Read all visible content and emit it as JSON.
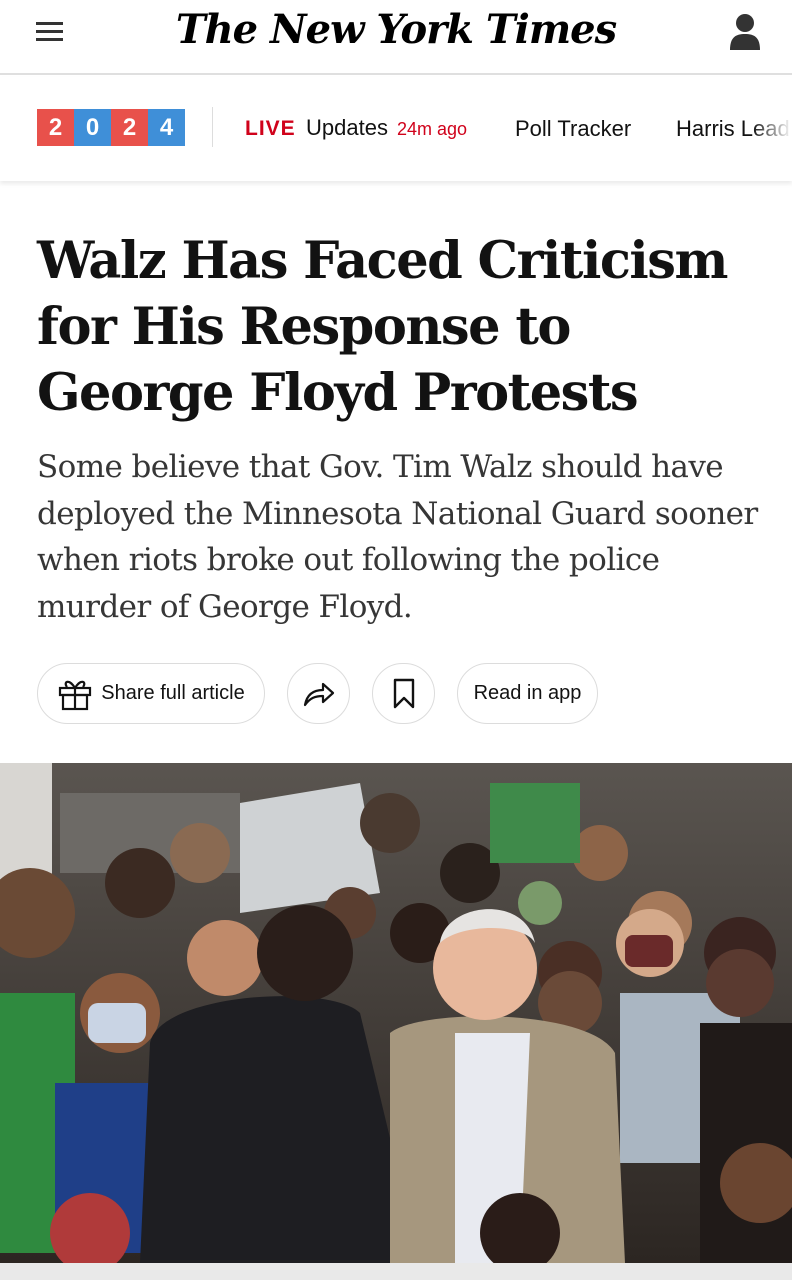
{
  "masthead": {
    "logo_text": "The New York Times",
    "menu_icon": "hamburger-menu-icon",
    "account_icon": "account-user-icon"
  },
  "subnav": {
    "year_digits": [
      "2",
      "0",
      "2",
      "4"
    ],
    "year_colors": [
      "#e8514b",
      "#3f8fd8",
      "#e8514b",
      "#3f8fd8"
    ],
    "live_label": "LIVE",
    "updates_label": "Updates",
    "updated_ago": "24m ago",
    "links": [
      "Poll Tracker",
      "Harris Lead"
    ]
  },
  "article": {
    "headline": "Walz Has Faced Criticism for His Response to George Floyd Protests",
    "summary": "Some believe that Gov. Tim Walz should have deployed the Minnesota National Guard sooner when riots broke out following the police murder of George Floyd."
  },
  "actions": {
    "share_label": "Share full article",
    "share_icon": "gift-icon",
    "forward_icon": "share-arrow-icon",
    "save_icon": "bookmark-icon",
    "read_in_app_label": "Read in app"
  },
  "colors": {
    "live_red": "#d0021b",
    "text": "#121212",
    "summary_text": "#363636",
    "border": "#dcdcdc"
  }
}
